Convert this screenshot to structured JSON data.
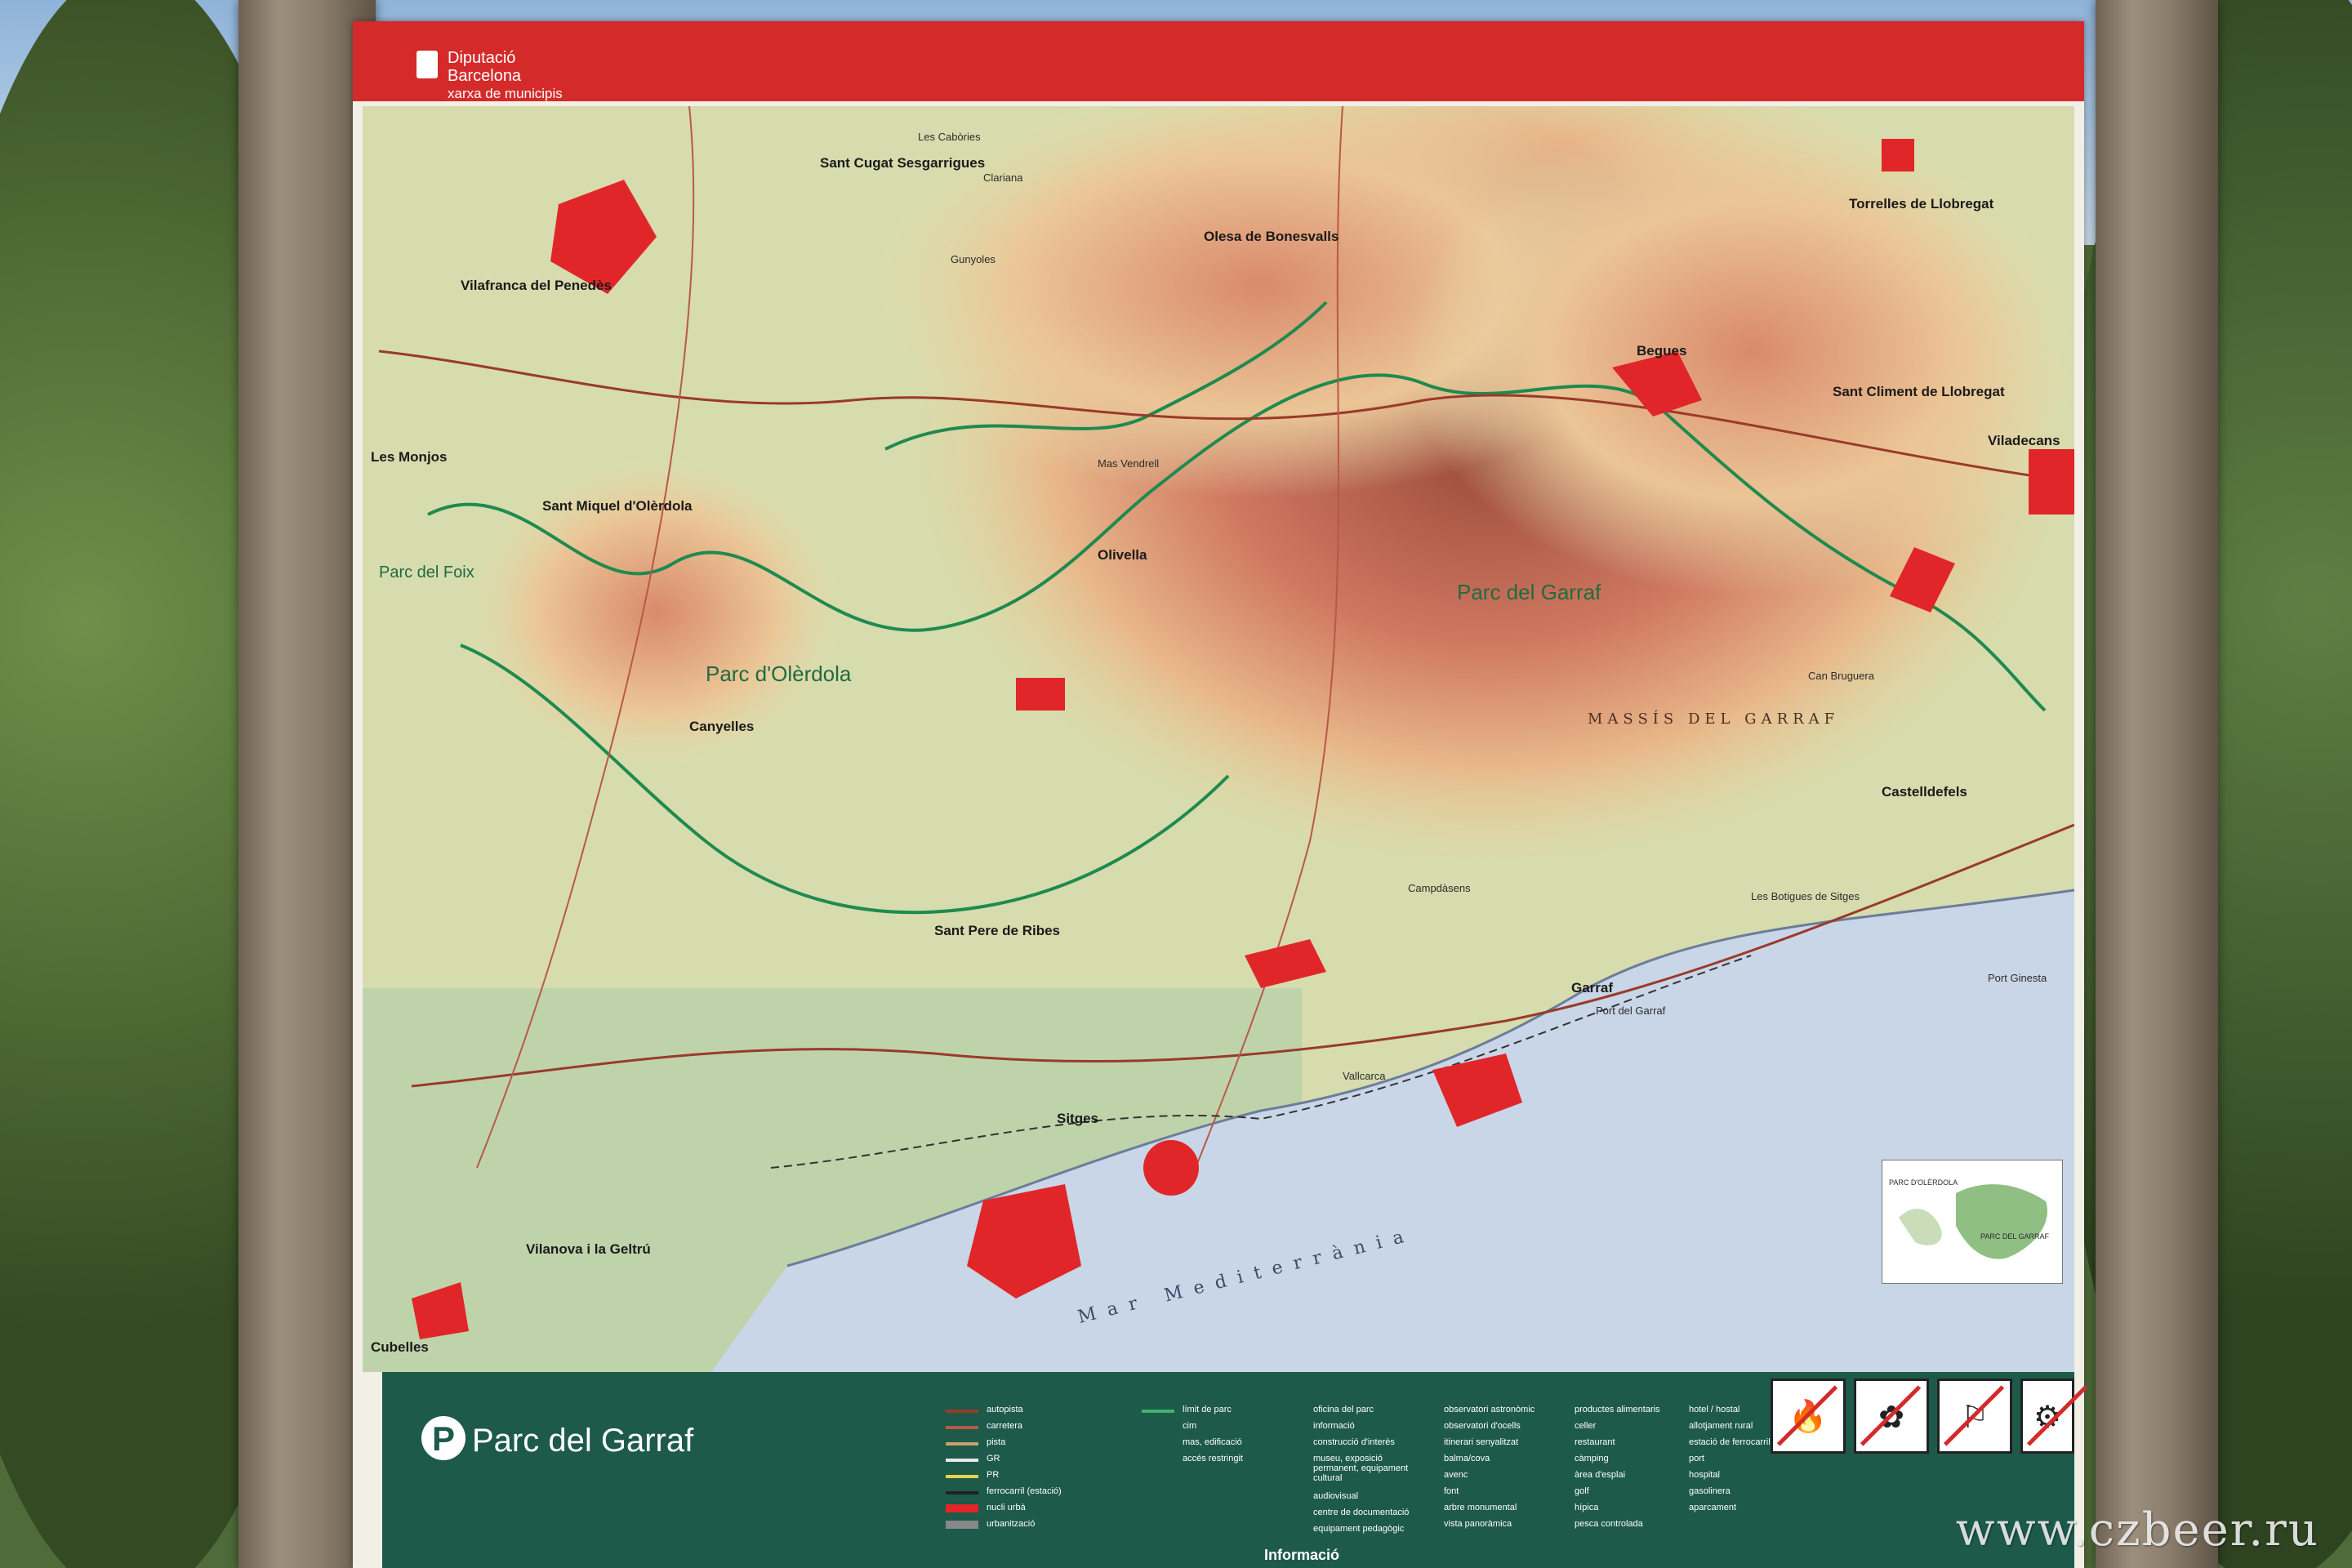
{
  "header": {
    "logo_line1": "Diputació",
    "logo_line2": "Barcelona",
    "logo_line3": "xarxa de municipis"
  },
  "map_labels": {
    "parks": [
      "Parc del Garraf",
      "Parc d'Olèrdola",
      "Parc del Foix"
    ],
    "massif": "MASSÍS DEL GARRAF",
    "sea": "Mar Mediterrània",
    "towns": [
      "Vilafranca del Penedès",
      "Sant Cugat Sesgarrigues",
      "Olesa de Bonesvalls",
      "Torrelles de Llobregat",
      "Sant Climent de Llobregat",
      "Viladecans",
      "Begues",
      "Castelldefels",
      "Sant Pere de Ribes",
      "Sitges",
      "Garraf",
      "Vilanova i la Geltrú",
      "Cubelles",
      "Canyelles",
      "Olivella",
      "Sant Miquel d'Olèrdola",
      "Les Monjos",
      "Port Ginesta",
      "Vallcarca",
      "Port del Garraf",
      "Les Cabòries",
      "Gunyoles",
      "Clariana",
      "Campdàsens",
      "Mas Vendrell",
      "Can Bruguera",
      "Les Botigues de Sitges"
    ],
    "inset_labels": [
      "PARC D'OLÈRDOLA",
      "PARC DEL GARRAF"
    ]
  },
  "legend": {
    "title": "Parc del Garraf",
    "roads": [
      "autopista",
      "carretera",
      "pista",
      "GR",
      "PR",
      "ferrocarril (estació)",
      "nucli urbà",
      "urbanització"
    ],
    "limits": [
      "límit de parc",
      "cim",
      "mas, edificació",
      "accés restringit"
    ],
    "facilities_col1": [
      "oficina del parc",
      "informació",
      "construcció d'interès",
      "museu, exposició permanent, equipament cultural",
      "audiovisual",
      "centre de documentació",
      "equipament pedagògic"
    ],
    "facilities_col2": [
      "observatori astronòmic",
      "observatori d'ocells",
      "itinerari senyalitzat",
      "balma/cova",
      "avenc",
      "font",
      "arbre monumental",
      "vista panoràmica"
    ],
    "facilities_col3": [
      "productes alimentaris",
      "celler",
      "restaurant",
      "càmping",
      "àrea d'esplai",
      "golf",
      "hípica",
      "pesca controlada"
    ],
    "facilities_col4": [
      "hotel / hostal",
      "allotjament rural",
      "estació de ferrocarril",
      "port",
      "hospital",
      "gasolinera",
      "aparcament"
    ],
    "footer": "Informació",
    "ban_icons": [
      "no-fire-icon",
      "no-picking-flowers-icon",
      "no-littering-icon",
      "no-motorbike-icon"
    ]
  },
  "colors": {
    "header_red": "#d42a2a",
    "legend_green": "#1d5a4a",
    "park_trail": "#1f8a4f",
    "urban": "#e1262a",
    "sea": "#c9d6e8"
  },
  "watermark": "www.czbeer.ru"
}
